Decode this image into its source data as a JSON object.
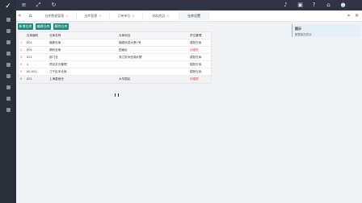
{
  "sidebar": {
    "logo_icon": "checkmark-logo-icon",
    "items": [
      "grid-icon",
      "menu-icon",
      "document-icon",
      "folder-icon",
      "settings-icon",
      "chart-icon",
      "list-icon",
      "gauge-icon",
      "search-icon"
    ]
  },
  "topbar": {
    "left_icons": [
      "menu-toggle-icon",
      "fullscreen-icon",
      "refresh-icon"
    ],
    "right_icons": [
      "bell-icon",
      "cart-icon",
      "help-icon",
      "home-icon",
      "user-icon"
    ]
  },
  "tabs": [
    {
      "label": "仓库数据管理"
    },
    {
      "label": "出库管理"
    },
    {
      "label": "订单单位"
    },
    {
      "label": "材料商品"
    },
    {
      "label": "仓库设置",
      "active": true
    }
  ],
  "toolbar": {
    "buttons": [
      "新增仓库",
      "编辑仓库",
      "删除仓库"
    ]
  },
  "table": {
    "columns": [
      "",
      "仓库编码",
      "仓库名称",
      "仓库地址",
      "货位管理"
    ],
    "rows": [
      {
        "n": "1",
        "code": "001",
        "name": "福费仓库",
        "addr": "福费科技大厦1号",
        "status": "建账在库",
        "neg": false
      },
      {
        "n": "2",
        "code": "001",
        "name": "原料仓库",
        "addr": "园南区",
        "status": "待建账",
        "neg": true
      },
      {
        "n": "3",
        "code": "021",
        "name": "部门仓",
        "addr": "浙江杭州西湖大厦",
        "status": "建账在库",
        "neg": false
      },
      {
        "n": "4",
        "code": "1",
        "name": "项目并仓管理",
        "addr": "",
        "status": "建账在库",
        "neg": false
      },
      {
        "n": "5",
        "code": "00-001",
        "name": "江干区本仓库",
        "addr": "",
        "status": "建账在库",
        "neg": false
      },
      {
        "n": "6",
        "code": "001",
        "name": "上海直营仓",
        "addr": "大华园区",
        "status": "待建账",
        "neg": true
      }
    ]
  },
  "notice": {
    "title": "提示",
    "message": "数据保存成功"
  }
}
